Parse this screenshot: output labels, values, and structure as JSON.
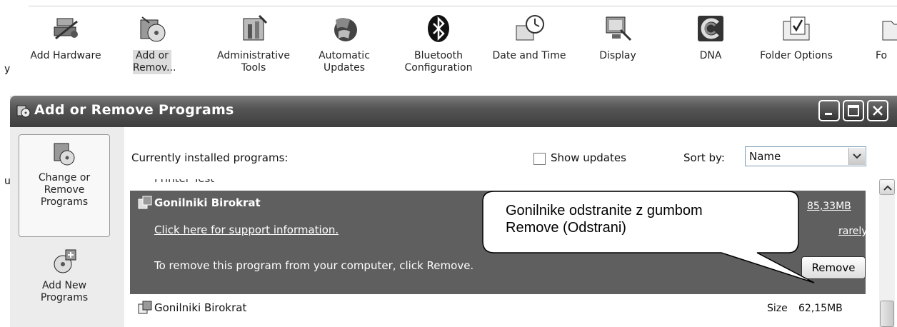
{
  "control_panel": {
    "edge_left_fragment": "y",
    "items": [
      {
        "label": "Add Hardware",
        "icon": "add-hardware-icon"
      },
      {
        "label": "Add or Remov...",
        "icon": "add-remove-programs-icon",
        "selected": true
      },
      {
        "label": "Administrative Tools",
        "icon": "administrative-tools-icon"
      },
      {
        "label": "Automatic Updates",
        "icon": "automatic-updates-icon"
      },
      {
        "label": "Bluetooth Configuration",
        "icon": "bluetooth-icon"
      },
      {
        "label": "Date and Time",
        "icon": "date-time-icon"
      },
      {
        "label": "Display",
        "icon": "display-icon"
      },
      {
        "label": "DNA",
        "icon": "dna-icon"
      },
      {
        "label": "Folder Options",
        "icon": "folder-options-icon"
      },
      {
        "label": "Fo",
        "icon": "fonts-icon"
      }
    ],
    "edge_fragment_2": "u"
  },
  "window": {
    "title": "Add or Remove Programs",
    "controls": [
      "minimize",
      "maximize",
      "close"
    ]
  },
  "taskpane": {
    "change_remove": "Change or Remove Programs",
    "add_new": "Add New Programs"
  },
  "main": {
    "installed_label": "Currently installed programs:",
    "show_updates": "Show updates",
    "sort_by_label": "Sort by:",
    "sort_by_value": "Name",
    "partial_row_text": "Printer Test",
    "selected_program": {
      "name": "Gonilniki Birokrat",
      "size": "85,33MB",
      "support_link": "Click here for support information.",
      "usage": "rarely",
      "instruction": "To remove this program from your computer, click Remove.",
      "remove_button": "Remove"
    },
    "next_program": {
      "name": "Gonilniki Birokrat",
      "size_label": "Size",
      "size": "62,15MB"
    }
  },
  "callout": {
    "line1": "Gonilnike odstranite z gumbom",
    "line2": "Remove (Odstrani)"
  }
}
